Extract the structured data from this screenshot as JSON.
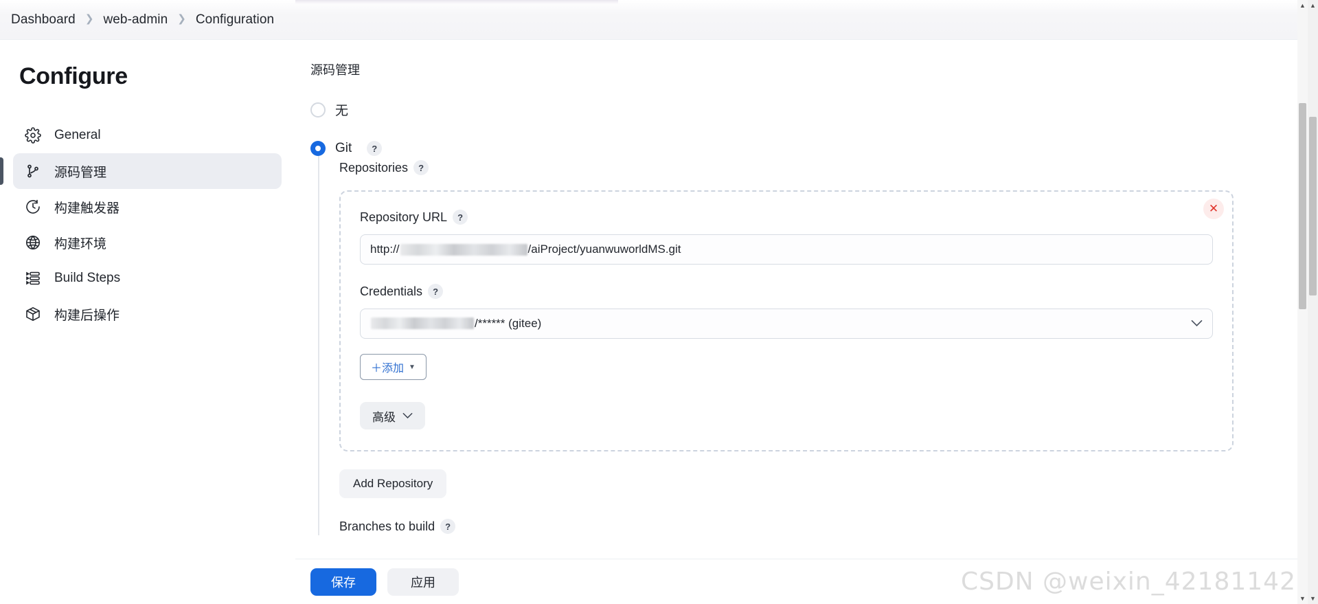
{
  "breadcrumb": {
    "items": [
      {
        "label": "Dashboard"
      },
      {
        "label": "web-admin"
      },
      {
        "label": "Configuration"
      }
    ],
    "separator": "❯"
  },
  "sidebar": {
    "title": "Configure",
    "items": [
      {
        "label": "General",
        "icon": "gear-icon",
        "active": false
      },
      {
        "label": "源码管理",
        "icon": "source-branch-icon",
        "active": true
      },
      {
        "label": "构建触发器",
        "icon": "clock-icon",
        "active": false
      },
      {
        "label": "构建环境",
        "icon": "globe-icon",
        "active": false
      },
      {
        "label": "Build Steps",
        "icon": "list-steps-icon",
        "active": false
      },
      {
        "label": "构建后操作",
        "icon": "package-icon",
        "active": false
      }
    ]
  },
  "main": {
    "section_title": "源码管理",
    "scm_options": [
      {
        "label": "无",
        "selected": false,
        "has_help": false
      },
      {
        "label": "Git",
        "selected": true,
        "has_help": true
      }
    ],
    "help_glyph": "?",
    "repositories_label": "Repositories",
    "repository": {
      "close_glyph": "✕",
      "url_label": "Repository URL",
      "url_prefix": "http://",
      "url_suffix": "/aiProject/yuanwuworldMS.git",
      "url_redacted": true,
      "credentials_label": "Credentials",
      "credentials_suffix": "/****** (gitee)",
      "credentials_redacted": true,
      "credentials_caret": "⌄",
      "add_button_label": "＋添加",
      "add_button_caret": "▼",
      "advanced_button_label": "高级",
      "advanced_button_caret": "⌄"
    },
    "add_repository_label": "Add Repository",
    "branches_label": "Branches to build"
  },
  "action_bar": {
    "save_label": "保存",
    "apply_label": "应用"
  },
  "watermark": "CSDN @weixin_42181142",
  "scrollbar": {
    "arrow_up": "▲",
    "arrow_down": "▼"
  },
  "colors": {
    "accent": "#1769e0",
    "danger": "#e0342c",
    "sidebar_active_bg": "#ebedf2"
  }
}
